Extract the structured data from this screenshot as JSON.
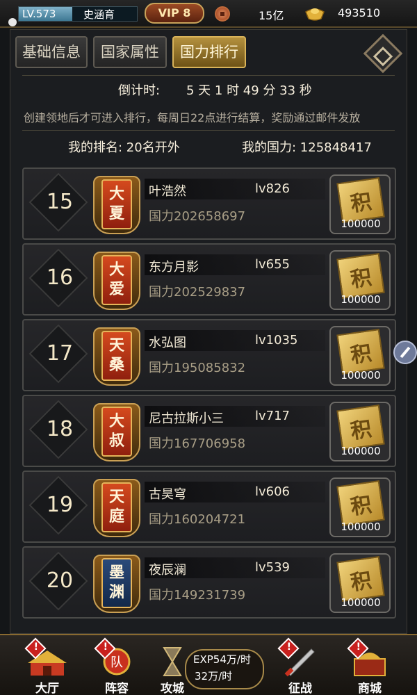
{
  "topbar": {
    "level": "LV.573",
    "level_progress_pct": 45,
    "player_name": "史涵育",
    "vip": "VIP 8",
    "coins": "15亿",
    "ingots": "493510"
  },
  "tabs": [
    {
      "label": "基础信息"
    },
    {
      "label": "国家属性"
    },
    {
      "label": "国力排行"
    }
  ],
  "header": {
    "countdown_label": "倒计时:",
    "countdown_value": "5 天 1 时 49 分 33 秒",
    "notice": "创建领地后才可进入排行，每周日22点进行结算，奖励通过邮件发放",
    "my_rank": "我的排名: 20名开外",
    "my_power": "我的国力: 125848417"
  },
  "rows": [
    {
      "rank": "15",
      "badge_top": "大",
      "badge_bottom": "夏",
      "name": "叶浩然",
      "level": "lv826",
      "power": "国力202658697",
      "reward": "100000"
    },
    {
      "rank": "16",
      "badge_top": "大",
      "badge_bottom": "爱",
      "name": "东方月影",
      "level": "lv655",
      "power": "国力202529837",
      "reward": "100000"
    },
    {
      "rank": "17",
      "badge_top": "天",
      "badge_bottom": "桑",
      "name": "水弘图",
      "level": "lv1035",
      "power": "国力195085832",
      "reward": "100000"
    },
    {
      "rank": "18",
      "badge_top": "大",
      "badge_bottom": "叔",
      "name": "尼古拉斯小三",
      "level": "lv717",
      "power": "国力167706958",
      "reward": "100000"
    },
    {
      "rank": "19",
      "badge_top": "天",
      "badge_bottom": "庭",
      "name": "古昊穹",
      "level": "lv606",
      "power": "国力160204721",
      "reward": "100000"
    },
    {
      "rank": "20",
      "badge_top": "墨",
      "badge_bottom": "渊",
      "name": "夜辰澜",
      "level": "lv539",
      "power": "国力149231739",
      "reward": "100000"
    }
  ],
  "reward_icon_char": "积",
  "bottom_nav": {
    "hall": "大厅",
    "lineup": "阵容",
    "siege": "攻城",
    "exp_rate": "EXP54万/时",
    "coin_rate": "32万/时",
    "campaign": "征战",
    "shop": "商城",
    "alert_mark": "!"
  },
  "colors": {
    "accent_gold": "#b4913e",
    "badge_red": "#d54a1e",
    "badge_blue": "#2a4a7a",
    "alert_red": "#c8201e"
  }
}
